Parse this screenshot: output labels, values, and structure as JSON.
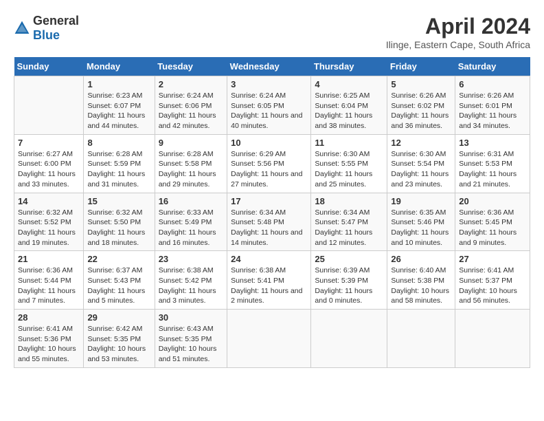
{
  "logo": {
    "general": "General",
    "blue": "Blue"
  },
  "title": "April 2024",
  "subtitle": "Ilinge, Eastern Cape, South Africa",
  "weekdays": [
    "Sunday",
    "Monday",
    "Tuesday",
    "Wednesday",
    "Thursday",
    "Friday",
    "Saturday"
  ],
  "weeks": [
    [
      {
        "day": "",
        "info": ""
      },
      {
        "day": "1",
        "info": "Sunrise: 6:23 AM\nSunset: 6:07 PM\nDaylight: 11 hours\nand 44 minutes."
      },
      {
        "day": "2",
        "info": "Sunrise: 6:24 AM\nSunset: 6:06 PM\nDaylight: 11 hours\nand 42 minutes."
      },
      {
        "day": "3",
        "info": "Sunrise: 6:24 AM\nSunset: 6:05 PM\nDaylight: 11 hours\nand 40 minutes."
      },
      {
        "day": "4",
        "info": "Sunrise: 6:25 AM\nSunset: 6:04 PM\nDaylight: 11 hours\nand 38 minutes."
      },
      {
        "day": "5",
        "info": "Sunrise: 6:26 AM\nSunset: 6:02 PM\nDaylight: 11 hours\nand 36 minutes."
      },
      {
        "day": "6",
        "info": "Sunrise: 6:26 AM\nSunset: 6:01 PM\nDaylight: 11 hours\nand 34 minutes."
      }
    ],
    [
      {
        "day": "7",
        "info": "Sunrise: 6:27 AM\nSunset: 6:00 PM\nDaylight: 11 hours\nand 33 minutes."
      },
      {
        "day": "8",
        "info": "Sunrise: 6:28 AM\nSunset: 5:59 PM\nDaylight: 11 hours\nand 31 minutes."
      },
      {
        "day": "9",
        "info": "Sunrise: 6:28 AM\nSunset: 5:58 PM\nDaylight: 11 hours\nand 29 minutes."
      },
      {
        "day": "10",
        "info": "Sunrise: 6:29 AM\nSunset: 5:56 PM\nDaylight: 11 hours\nand 27 minutes."
      },
      {
        "day": "11",
        "info": "Sunrise: 6:30 AM\nSunset: 5:55 PM\nDaylight: 11 hours\nand 25 minutes."
      },
      {
        "day": "12",
        "info": "Sunrise: 6:30 AM\nSunset: 5:54 PM\nDaylight: 11 hours\nand 23 minutes."
      },
      {
        "day": "13",
        "info": "Sunrise: 6:31 AM\nSunset: 5:53 PM\nDaylight: 11 hours\nand 21 minutes."
      }
    ],
    [
      {
        "day": "14",
        "info": "Sunrise: 6:32 AM\nSunset: 5:52 PM\nDaylight: 11 hours\nand 19 minutes."
      },
      {
        "day": "15",
        "info": "Sunrise: 6:32 AM\nSunset: 5:50 PM\nDaylight: 11 hours\nand 18 minutes."
      },
      {
        "day": "16",
        "info": "Sunrise: 6:33 AM\nSunset: 5:49 PM\nDaylight: 11 hours\nand 16 minutes."
      },
      {
        "day": "17",
        "info": "Sunrise: 6:34 AM\nSunset: 5:48 PM\nDaylight: 11 hours\nand 14 minutes."
      },
      {
        "day": "18",
        "info": "Sunrise: 6:34 AM\nSunset: 5:47 PM\nDaylight: 11 hours\nand 12 minutes."
      },
      {
        "day": "19",
        "info": "Sunrise: 6:35 AM\nSunset: 5:46 PM\nDaylight: 11 hours\nand 10 minutes."
      },
      {
        "day": "20",
        "info": "Sunrise: 6:36 AM\nSunset: 5:45 PM\nDaylight: 11 hours\nand 9 minutes."
      }
    ],
    [
      {
        "day": "21",
        "info": "Sunrise: 6:36 AM\nSunset: 5:44 PM\nDaylight: 11 hours\nand 7 minutes."
      },
      {
        "day": "22",
        "info": "Sunrise: 6:37 AM\nSunset: 5:43 PM\nDaylight: 11 hours\nand 5 minutes."
      },
      {
        "day": "23",
        "info": "Sunrise: 6:38 AM\nSunset: 5:42 PM\nDaylight: 11 hours\nand 3 minutes."
      },
      {
        "day": "24",
        "info": "Sunrise: 6:38 AM\nSunset: 5:41 PM\nDaylight: 11 hours\nand 2 minutes."
      },
      {
        "day": "25",
        "info": "Sunrise: 6:39 AM\nSunset: 5:39 PM\nDaylight: 11 hours\nand 0 minutes."
      },
      {
        "day": "26",
        "info": "Sunrise: 6:40 AM\nSunset: 5:38 PM\nDaylight: 10 hours\nand 58 minutes."
      },
      {
        "day": "27",
        "info": "Sunrise: 6:41 AM\nSunset: 5:37 PM\nDaylight: 10 hours\nand 56 minutes."
      }
    ],
    [
      {
        "day": "28",
        "info": "Sunrise: 6:41 AM\nSunset: 5:36 PM\nDaylight: 10 hours\nand 55 minutes."
      },
      {
        "day": "29",
        "info": "Sunrise: 6:42 AM\nSunset: 5:35 PM\nDaylight: 10 hours\nand 53 minutes."
      },
      {
        "day": "30",
        "info": "Sunrise: 6:43 AM\nSunset: 5:35 PM\nDaylight: 10 hours\nand 51 minutes."
      },
      {
        "day": "",
        "info": ""
      },
      {
        "day": "",
        "info": ""
      },
      {
        "day": "",
        "info": ""
      },
      {
        "day": "",
        "info": ""
      }
    ]
  ]
}
